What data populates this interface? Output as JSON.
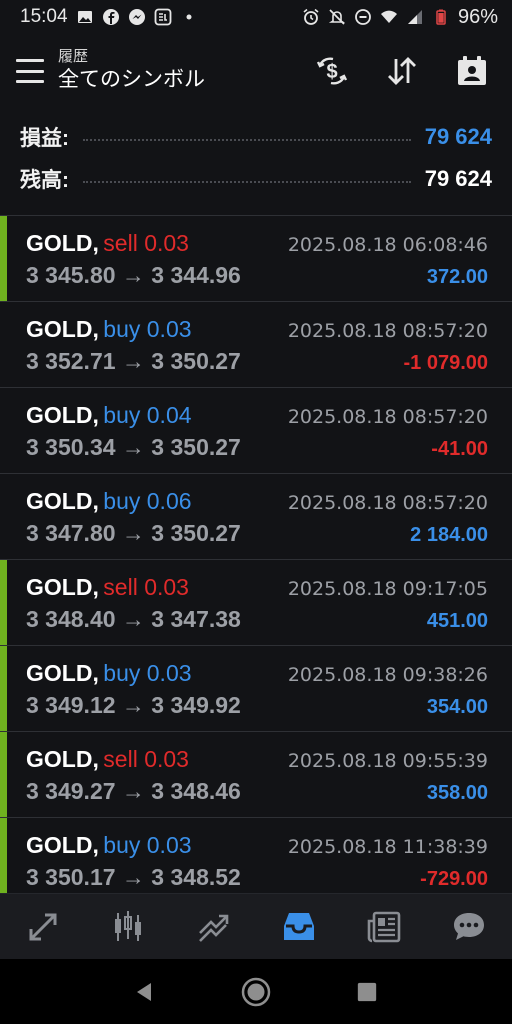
{
  "status_bar": {
    "time": "15:04",
    "battery": "96%",
    "left_icons": [
      "gallery-icon",
      "facebook-icon",
      "messenger-icon",
      "app-icon",
      "dot-icon"
    ],
    "right_icons": [
      "alarm-icon",
      "mute-icon",
      "dnd-icon",
      "wifi-icon",
      "signal-icon",
      "battery-icon"
    ]
  },
  "appbar": {
    "subtitle": "履歴",
    "title": "全てのシンボル"
  },
  "summary": {
    "profit_label": "損益:",
    "profit_value": "79 624",
    "balance_label": "残高:",
    "balance_value": "79 624"
  },
  "deals": [
    {
      "symbol": "GOLD,",
      "side": "sell",
      "volume": "sell 0.03",
      "prices": "3 345.80 → 3 344.96",
      "time": "2025.08.18 06:08:46",
      "profit": "372.00",
      "profit_sign": "pos",
      "highlight": true
    },
    {
      "symbol": "GOLD,",
      "side": "buy",
      "volume": "buy 0.03",
      "prices": "3 352.71 → 3 350.27",
      "time": "2025.08.18 08:57:20",
      "profit": "-1 079.00",
      "profit_sign": "neg",
      "highlight": false
    },
    {
      "symbol": "GOLD,",
      "side": "buy",
      "volume": "buy 0.04",
      "prices": "3 350.34 → 3 350.27",
      "time": "2025.08.18 08:57:20",
      "profit": "-41.00",
      "profit_sign": "neg",
      "highlight": false
    },
    {
      "symbol": "GOLD,",
      "side": "buy",
      "volume": "buy 0.06",
      "prices": "3 347.80 → 3 350.27",
      "time": "2025.08.18 08:57:20",
      "profit": "2 184.00",
      "profit_sign": "pos",
      "highlight": false
    },
    {
      "symbol": "GOLD,",
      "side": "sell",
      "volume": "sell 0.03",
      "prices": "3 348.40 → 3 347.38",
      "time": "2025.08.18 09:17:05",
      "profit": "451.00",
      "profit_sign": "pos",
      "highlight": true
    },
    {
      "symbol": "GOLD,",
      "side": "buy",
      "volume": "buy 0.03",
      "prices": "3 349.12 → 3 349.92",
      "time": "2025.08.18 09:38:26",
      "profit": "354.00",
      "profit_sign": "pos",
      "highlight": true
    },
    {
      "symbol": "GOLD,",
      "side": "sell",
      "volume": "sell 0.03",
      "prices": "3 349.27 → 3 348.46",
      "time": "2025.08.18 09:55:39",
      "profit": "358.00",
      "profit_sign": "pos",
      "highlight": true
    },
    {
      "symbol": "GOLD,",
      "side": "buy",
      "volume": "buy 0.03",
      "prices": "3 350.17 → 3 348.52",
      "time": "2025.08.18 11:38:39",
      "profit": "-729.00",
      "profit_sign": "neg",
      "highlight": true
    }
  ],
  "tabs": [
    {
      "name": "quotes-tab",
      "icon": "quotes-icon",
      "active": false
    },
    {
      "name": "chart-tab",
      "icon": "candlestick-icon",
      "active": false
    },
    {
      "name": "trade-tab",
      "icon": "trade-icon",
      "active": false
    },
    {
      "name": "history-tab",
      "icon": "inbox-icon",
      "active": true
    },
    {
      "name": "news-tab",
      "icon": "newspaper-icon",
      "active": false
    },
    {
      "name": "messages-tab",
      "icon": "chat-icon",
      "active": false
    }
  ],
  "colors": {
    "background": "#121316",
    "blue": "#3a8fe8",
    "red": "#e02b2b",
    "green_bar": "#6fb21f",
    "muted": "#9da0a6"
  }
}
